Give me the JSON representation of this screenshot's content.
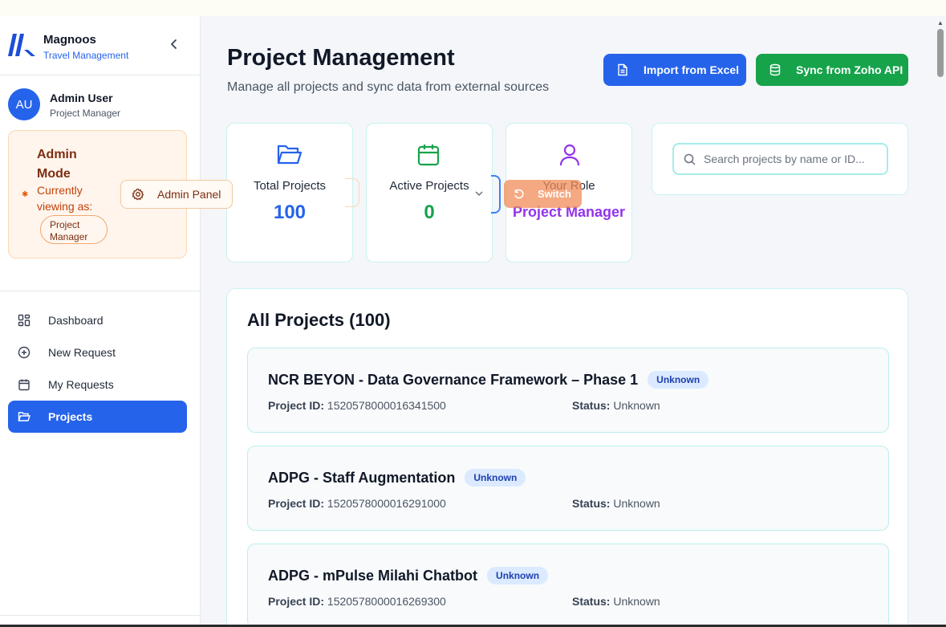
{
  "brand": {
    "name": "Magnoos",
    "subtitle": "Travel Management"
  },
  "user": {
    "initials": "AU",
    "name": "Admin User",
    "role": "Project Manager"
  },
  "admin_mode": {
    "title": "Admin Mode",
    "viewing_label": "Currently viewing as:",
    "viewing_role": "Project Manager",
    "panel_button": "Admin Panel",
    "switch_button": "Switch"
  },
  "nav": [
    {
      "label": "Dashboard",
      "icon": "dashboard-grid-icon",
      "active": false
    },
    {
      "label": "New Request",
      "icon": "plus-circle-icon",
      "active": false
    },
    {
      "label": "My Requests",
      "icon": "calendar-icon",
      "active": false
    },
    {
      "label": "Projects",
      "icon": "folder-open-icon",
      "active": true
    }
  ],
  "header": {
    "title": "Project Management",
    "subtitle": "Manage all projects and sync data from external sources",
    "import_button": "Import from Excel",
    "sync_button": "Sync from Zoho API"
  },
  "stats": {
    "total": {
      "label": "Total Projects",
      "value": "100",
      "color": "#2563eb",
      "icon": "folder-open-icon"
    },
    "active": {
      "label": "Active Projects",
      "value": "0",
      "color": "#16a34a",
      "icon": "calendar-icon"
    },
    "role": {
      "label": "Your Role",
      "value": "Project Manager",
      "color": "#9333ea",
      "icon": "user-icon"
    }
  },
  "search": {
    "placeholder": "Search projects by name or ID..."
  },
  "projects": {
    "heading": "All Projects (100)",
    "id_label": "Project ID:",
    "status_label": "Status:",
    "items": [
      {
        "name": "NCR BEYON - Data Governance Framework – Phase 1",
        "badge": "Unknown",
        "id": "1520578000016341500",
        "status": "Unknown"
      },
      {
        "name": "ADPG - Staff Augmentation",
        "badge": "Unknown",
        "id": "1520578000016291000",
        "status": "Unknown"
      },
      {
        "name": "ADPG - mPulse Milahi Chatbot",
        "badge": "Unknown",
        "id": "1520578000016269300",
        "status": "Unknown"
      }
    ]
  },
  "colors": {
    "primary": "#2563eb",
    "success": "#16a34a",
    "accent_purple": "#9333ea",
    "admin_bg": "#fff5ec"
  }
}
